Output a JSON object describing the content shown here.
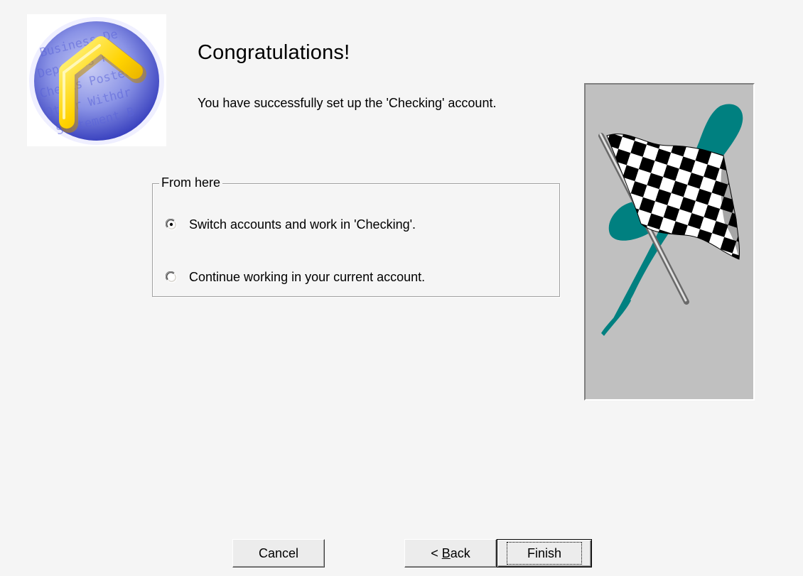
{
  "heading": "Congratulations!",
  "message": "You have successfully set up the 'Checking' account.",
  "options_group": {
    "label": "From here",
    "options": [
      {
        "label": "Switch accounts and work in 'Checking'.",
        "selected": true
      },
      {
        "label": "Continue working in your current account.",
        "selected": false
      }
    ]
  },
  "logo": {
    "icon": "house-globe-icon",
    "watermark_words": [
      "Business",
      "Deposits",
      "Checks Posted",
      "Other Withdrawals",
      "Statement"
    ]
  },
  "illustration": {
    "icon": "checkered-flag-icon",
    "accent_color": "#008080"
  },
  "buttons": {
    "cancel": "Cancel",
    "back_prefix": "< ",
    "back_mnemonic": "B",
    "back_rest": "ack",
    "finish": "Finish"
  }
}
